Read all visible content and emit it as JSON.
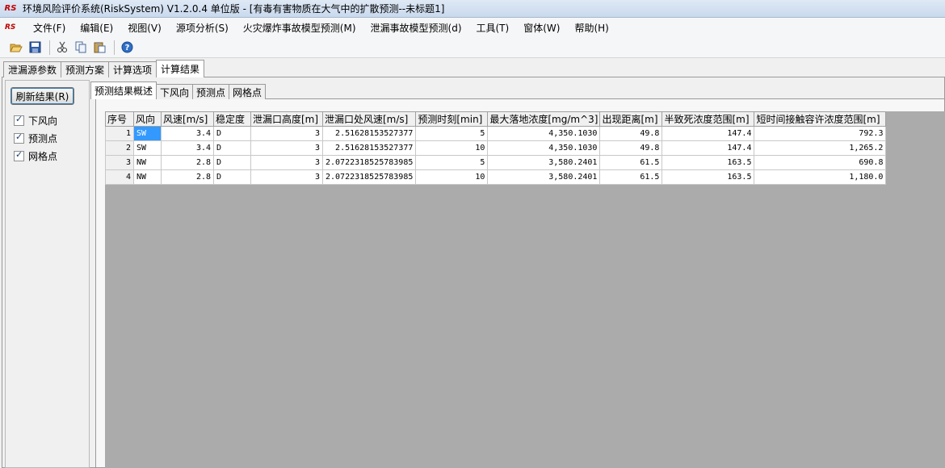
{
  "window": {
    "logo_text": "RS",
    "title": "环境风险评价系统(RiskSystem) V1.2.0.4 单位版 - [有毒有害物质在大气中的扩散预测--未标题1]"
  },
  "menu": {
    "logo_text": "RS",
    "items": [
      "文件(F)",
      "编辑(E)",
      "视图(V)",
      "源项分析(S)",
      "火灾爆炸事故模型预测(M)",
      "泄漏事故模型预测(d)",
      "工具(T)",
      "窗体(W)",
      "帮助(H)"
    ]
  },
  "toolbar": {
    "buttons": [
      "open-folder-icon",
      "save-icon",
      "cut-icon",
      "copy-icon",
      "paste-icon",
      "help-icon"
    ]
  },
  "main_tabs": [
    {
      "label": "泄漏源参数",
      "active": false
    },
    {
      "label": "预测方案",
      "active": false
    },
    {
      "label": "计算选项",
      "active": false
    },
    {
      "label": "计算结果",
      "active": true
    }
  ],
  "left_panel": {
    "refresh_label": "刷新结果(R)",
    "checkboxes": [
      {
        "label": "下风向",
        "checked": true
      },
      {
        "label": "预测点",
        "checked": true
      },
      {
        "label": "网格点",
        "checked": true
      }
    ]
  },
  "sub_tabs": [
    {
      "label": "预测结果概述",
      "active": true
    },
    {
      "label": "下风向",
      "active": false
    },
    {
      "label": "预测点",
      "active": false
    },
    {
      "label": "网格点",
      "active": false
    }
  ],
  "grid": {
    "columns": [
      "序号",
      "风向",
      "风速[m/s]",
      "稳定度",
      "泄漏口高度[m]",
      "泄漏口处风速[m/s]",
      "预测时刻[min]",
      "最大落地浓度[mg/m^3]",
      "出现距离[m]",
      "半致死浓度范围[m]",
      "短时间接触容许浓度范围[m]"
    ],
    "rows": [
      [
        "1",
        "SW",
        "3.4",
        "D",
        "3",
        "2.51628153527377",
        "5",
        "4,350.1030",
        "49.8",
        "147.4",
        "792.3"
      ],
      [
        "2",
        "SW",
        "3.4",
        "D",
        "3",
        "2.51628153527377",
        "10",
        "4,350.1030",
        "49.8",
        "147.4",
        "1,265.2"
      ],
      [
        "3",
        "NW",
        "2.8",
        "D",
        "3",
        "2.0722318525783985",
        "5",
        "3,580.2401",
        "61.5",
        "163.5",
        "690.8"
      ],
      [
        "4",
        "NW",
        "2.8",
        "D",
        "3",
        "2.0722318525783985",
        "10",
        "3,580.2401",
        "61.5",
        "163.5",
        "1,180.0"
      ]
    ],
    "selected_cell": {
      "row": 0,
      "col": 1
    }
  }
}
